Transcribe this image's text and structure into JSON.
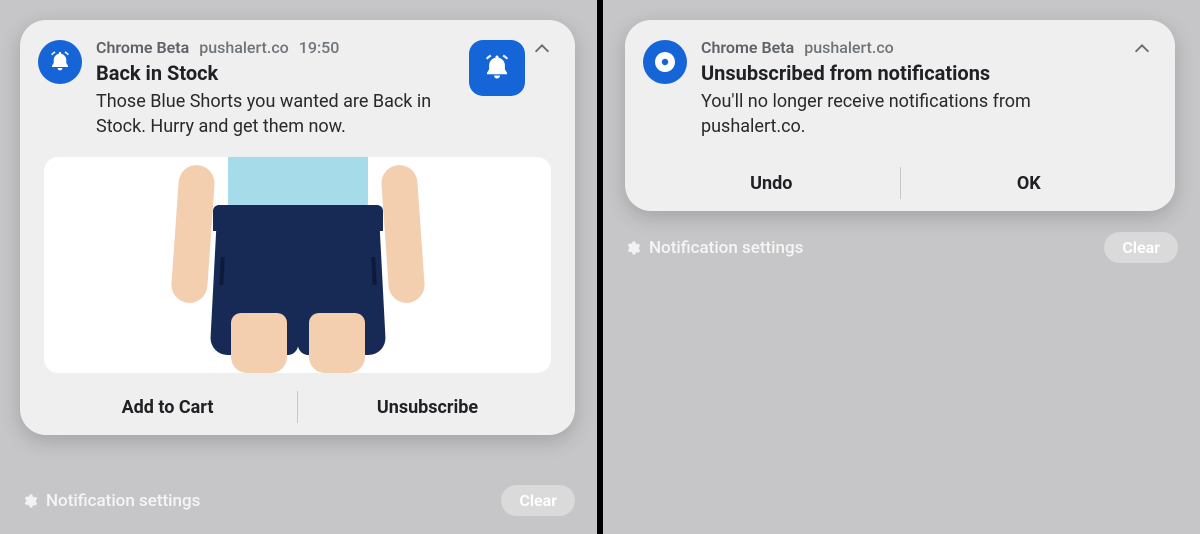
{
  "left": {
    "app": "Chrome Beta",
    "domain": "pushalert.co",
    "time": "19:50",
    "title": "Back in Stock",
    "body": "Those Blue Shorts you wanted are Back in Stock. Hurry and get them now.",
    "icon": "bell-icon",
    "thumb_icon": "bell-icon",
    "image_alt": "Model wearing blue shorts",
    "actions": {
      "primary": "Add to Cart",
      "secondary": "Unsubscribe"
    }
  },
  "right": {
    "app": "Chrome Beta",
    "domain": "pushalert.co",
    "title": "Unsubscribed from notifications",
    "body": "You'll no longer receive notifications from pushalert.co.",
    "icon": "chrome-icon",
    "actions": {
      "primary": "Undo",
      "secondary": "OK"
    }
  },
  "footer": {
    "settings": "Notification settings",
    "clear": "Clear"
  }
}
